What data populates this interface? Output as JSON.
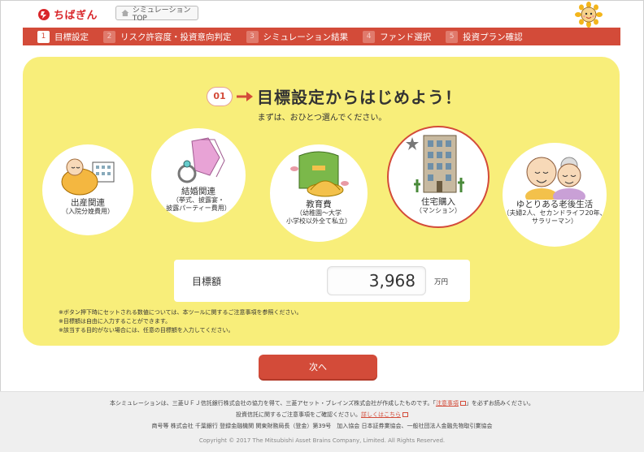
{
  "brand": {
    "logo_text": "ちばぎん",
    "accent": "#d34b39",
    "panel_color": "#f8ee7a"
  },
  "header": {
    "top_button_label": "シミュレーションTOP",
    "home_icon": "home-icon"
  },
  "steps": [
    {
      "num": "1",
      "label": "目標設定",
      "active": true
    },
    {
      "num": "2",
      "label": "リスク許容度・投資意向判定",
      "active": false
    },
    {
      "num": "3",
      "label": "シミュレーション結果",
      "active": false
    },
    {
      "num": "4",
      "label": "ファンド選択",
      "active": false
    },
    {
      "num": "5",
      "label": "投資プラン確認",
      "active": false
    }
  ],
  "main": {
    "step_badge": "01",
    "title": "目標設定からはじめよう！",
    "subtitle": "まずは、おひとつ選んでください。",
    "goals": [
      {
        "title": "出産関連",
        "sub": "（入院分娩費用）",
        "selected": false
      },
      {
        "title": "結婚関連",
        "sub": "（挙式、披露宴・\n披露パーティー費用）",
        "selected": false
      },
      {
        "title": "教育費",
        "sub": "（幼稚園～大学\n小学校以外全て私立）",
        "selected": false
      },
      {
        "title": "住宅購入",
        "sub": "（マンション）",
        "selected": true
      },
      {
        "title": "ゆとりある老後生活",
        "sub": "（夫婦2人、セカンドライフ20年、\nサラリーマン）",
        "selected": false
      }
    ],
    "amount_label": "目標額",
    "amount_value": "3,968",
    "amount_unit": "万円",
    "notes": [
      "※ボタン押下時にセットされる数値については、本ツールに関するご注意事項を参照ください。",
      "※目標額は自由に入力することができます。",
      "※該当する目的がない場合には、任意の目標額を入力してください。"
    ],
    "next_label": "次へ"
  },
  "footer": {
    "line1_a": "本シミュレーションは、三菱ＵＦＪ信託銀行株式会社の協力を得て、三菱アセット・ブレインズ株式会社が作成したものです。「",
    "line1_link": "注意事項",
    "line1_b": "」を必ずお読みください。",
    "line2_a": "投資信託に関するご注意事項をご確認ください。",
    "line2_link": "詳しくはこちら",
    "line3": "商号等 株式会社 千葉銀行 登録金融機関 関東財務局長（登金）第39号　加入協会 日本証券業協会、一般社団法人金融先物取引業協会",
    "copyright": "Copyright © 2017 The Mitsubishi Asset Brains Company, Limited. All Rights Reserved."
  }
}
